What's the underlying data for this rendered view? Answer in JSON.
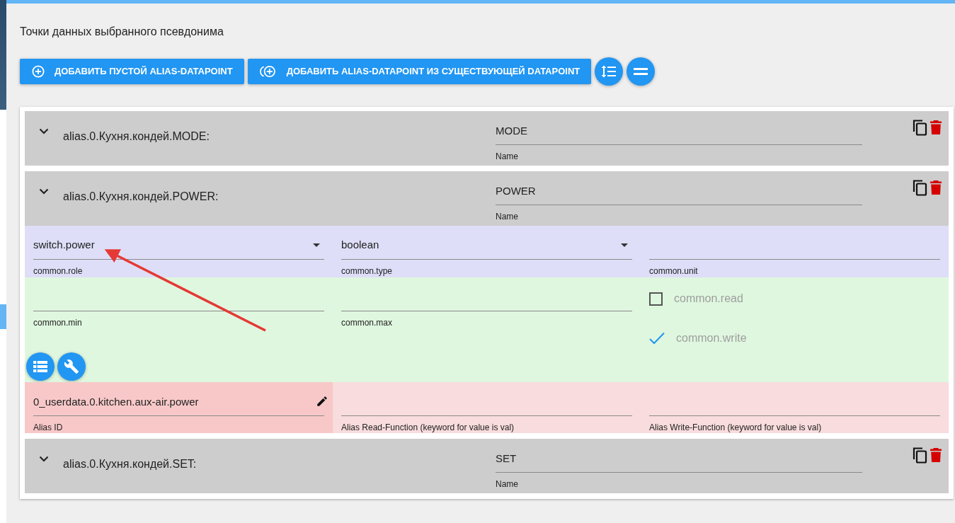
{
  "title": "Точки данных выбранного псевдонима",
  "buttons": [
    {
      "kind": "add-empty",
      "label": "ДОБАВИТЬ ПУСТОЙ ALIAS-DATAPOINT"
    },
    {
      "kind": "add-existing",
      "label": "ДОБАВИТЬ ALIAS-DATAPOINT ИЗ СУЩЕСТВУЮЩЕЙ DATAPOINT"
    }
  ],
  "datapoints": [
    {
      "id": "alias.0.Кухня.кондей.MODE:",
      "name_value": "MODE",
      "name_label": "Name"
    },
    {
      "id": "alias.0.Кухня.кондей.POWER:",
      "name_value": "POWER",
      "name_label": "Name",
      "details": {
        "role": {
          "value": "switch.power",
          "label": "common.role"
        },
        "type": {
          "value": "boolean",
          "label": "common.type"
        },
        "unit": {
          "label": "common.unit"
        },
        "min": {
          "label": "common.min"
        },
        "max": {
          "label": "common.max"
        },
        "flags": [
          {
            "label": "common.read",
            "checked": false
          },
          {
            "label": "common.write",
            "checked": true
          }
        ],
        "alias_id": {
          "value": "0_userdata.0.kitchen.aux-air.power",
          "label": "Alias ID"
        },
        "read_function": {
          "label": "Alias Read-Function (keyword for value is val)"
        },
        "write_function": {
          "label": "Alias Write-Function (keyword for value is val)"
        }
      }
    },
    {
      "id": "alias.0.Кухня.кондей.SET:",
      "name_value": "SET",
      "name_label": "Name"
    }
  ]
}
